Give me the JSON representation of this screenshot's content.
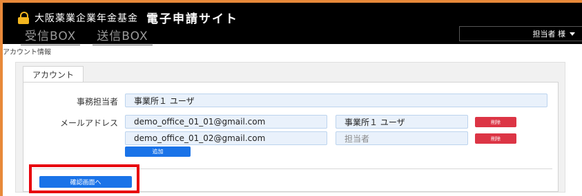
{
  "header": {
    "org_name": "大阪薬業企業年金基金",
    "app_name": "電子申請サイト",
    "tabs": [
      "受信BOX",
      "送信BOX"
    ],
    "user_menu": "担当者 様"
  },
  "breadcrumb": "アカウント情報",
  "panel": {
    "tab": "アカウント",
    "office_label": "事務担当者",
    "office_value": "事業所１ ユーザ",
    "email_label": "メールアドレス",
    "emails": [
      {
        "address": "demo_office_01_01@gmail.com",
        "name": "事業所１ ユーザ",
        "name_placeholder": false
      },
      {
        "address": "demo_office_01_02@gmail.com",
        "name": "担当者",
        "name_placeholder": true
      }
    ],
    "delete_label": "削除",
    "add_label": "追加",
    "confirm_label": "確認画面へ"
  },
  "colors": {
    "frame": "#e8893a",
    "accent_blue": "#1a73e8",
    "danger_red": "#dc3545",
    "highlight_red": "#e8000b",
    "lock": "#f3b61f"
  }
}
